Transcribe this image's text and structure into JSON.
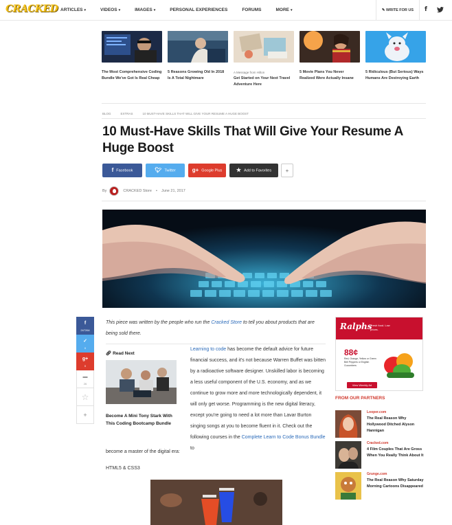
{
  "site": {
    "logo": "CRACKED",
    "nav": [
      "ARTICLES",
      "VIDEOS",
      "IMAGES",
      "PERSONAL EXPERIENCES",
      "FORUMS",
      "MORE"
    ],
    "nav_dropdown": [
      true,
      true,
      true,
      false,
      false,
      true
    ],
    "write_label": "WRITE FOR US"
  },
  "cards": [
    {
      "small": "",
      "title": "The Most Comprehensive Coding Bundle We've Got Is Real Cheap"
    },
    {
      "small": "",
      "title": "5 Reasons Growing Old In 2018 Is A Total Nightmare"
    },
    {
      "small": "A Message from Hilton",
      "title": "Get Started on Your Next Travel Adventure Here"
    },
    {
      "small": "",
      "title": "5 Movie Plans You Never Realized Were Actually Insane"
    },
    {
      "small": "",
      "title": "5 Ridiculous (But Serious) Ways Humans Are Destroying Earth"
    }
  ],
  "breadcrumbs": [
    "BLOG",
    "EXTRAS",
    "10 MUST-HAVE SKILLS THAT WILL GIVE YOUR RESUME A HUGE BOOST"
  ],
  "article": {
    "title": "10 Must-Have Skills That Will Give Your Resume A Huge Boost",
    "by": "By",
    "author": "CRACKED Store",
    "date": "June 21, 2017",
    "intro_pre": "This piece was written by the people who run the ",
    "intro_link": "Cracked Store",
    "intro_post": " to tell you about products that are being sold there.",
    "body_link1": "Learning to code",
    "body_text1": " has become the default advice for future financial success, and it's not because Warren Buffet was bitten by a radioactive software designer. Unskilled labor is becoming a less useful component of the U.S. economy, and as we continue to grow more and more technologically dependent, it will only get worse. Programming is the new digital literacy, except you're going to need a lot more than Lavar Burton singing songs at you to become fluent in it. Check out the following courses in the ",
    "body_link2": "Complete Learn to Code Bonus Bundle",
    "body_text2": " to",
    "body_tail": "become a master of the digital era:",
    "html5_label": "HTML5 & CSS3"
  },
  "share": {
    "facebook": "Facebook",
    "twitter": "Twitter",
    "google": "Google Plus",
    "favorites": "Add to Favorites",
    "more": "+"
  },
  "rail": {
    "fb_count": "247264",
    "tw_count": "0",
    "gp_count": "0",
    "comments": "26"
  },
  "read_next": {
    "label": "Read Next",
    "title": "Become A Mini Tony Stark With This Coding Bootcamp Bundle"
  },
  "ad": {
    "brand": "Ralphs",
    "tag": "Fresh food. Low prices.",
    "price": "88¢",
    "desc": "Red, Orange, Yellow or Green Bell Peppers or English Cucumbers",
    "cta": "View Weekly Ad"
  },
  "partners": {
    "heading": "FROM OUR PARTNERS",
    "items": [
      {
        "source": "Looper.com",
        "title": "The Real Reason Why Hollywood Ditched Alyson Hannigan"
      },
      {
        "source": "Cracked.com",
        "title": "4 Film Couples That Are Gross When You Really Think About It"
      },
      {
        "source": "Grunge.com",
        "title": "The Real Reason Why Saturday Morning Cartoons Disappeared"
      }
    ]
  }
}
